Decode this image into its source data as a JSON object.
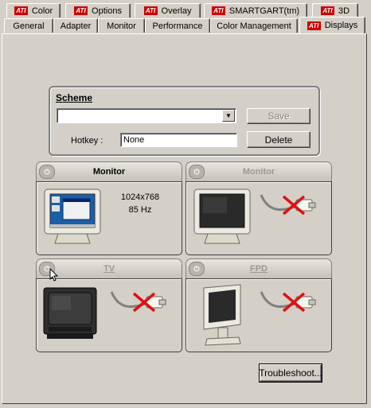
{
  "tabs_row1": [
    {
      "label": "Color",
      "ati": true
    },
    {
      "label": "Options",
      "ati": true
    },
    {
      "label": "Overlay",
      "ati": true
    },
    {
      "label": "SMARTGART(tm)",
      "ati": true
    },
    {
      "label": "3D",
      "ati": true
    }
  ],
  "tabs_row2": [
    {
      "label": "General"
    },
    {
      "label": "Adapter"
    },
    {
      "label": "Monitor"
    },
    {
      "label": "Performance"
    },
    {
      "label": "Color Management"
    },
    {
      "label": "Displays",
      "ati": true,
      "active": true
    }
  ],
  "ati_logo_text": "ATI",
  "scheme": {
    "label": "Scheme",
    "selected": "",
    "save_label": "Save",
    "delete_label": "Delete",
    "hotkey_label": "Hotkey :",
    "hotkey_value": "None"
  },
  "devices": [
    {
      "name": "Monitor",
      "enabled": true,
      "resolution": "1024x768",
      "refresh": "85 Hz",
      "icon": "crt-monitor-icon"
    },
    {
      "name": "Monitor",
      "enabled": false,
      "icon": "crt-monitor-icon"
    },
    {
      "name": "TV",
      "enabled": false,
      "icon": "tv-icon"
    },
    {
      "name": "FPD",
      "enabled": false,
      "icon": "flat-panel-icon"
    }
  ],
  "troubleshoot_label": "Troubleshoot...",
  "colors": {
    "dialog": "#d4d0c8",
    "ati_red": "#cc0000",
    "disconnect_x": "#e01010"
  }
}
